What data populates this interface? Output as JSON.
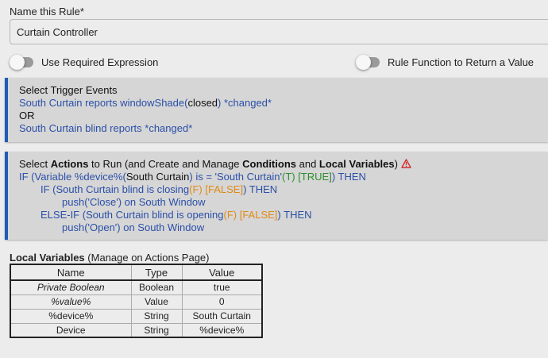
{
  "rule_name": {
    "label": "Name this Rule*",
    "value": "Curtain Controller"
  },
  "toggles": {
    "required_expression": {
      "label": "Use Required Expression",
      "on": false
    },
    "return_value": {
      "label": "Rule Function to Return a Value",
      "on": false
    }
  },
  "triggers": {
    "title": "Select Trigger Events",
    "line1_pre": "South Curtain reports windowShade(",
    "line1_val": "closed",
    "line1_post": ") *changed*",
    "or": "OR",
    "line2": "South Curtain blind reports *changed*"
  },
  "actions": {
    "title_pre": "Select ",
    "title_b1": "Actions",
    "title_mid1": " to Run (and Create and Manage ",
    "title_b2": "Conditions",
    "title_mid2": " and ",
    "title_b3": "Local Variables",
    "title_post": ")",
    "warning_icon": "warning-triangle-icon",
    "l1_a": "IF (Variable %device%(",
    "l1_b": "South Curtain",
    "l1_c": ") is = 'South Curtain'",
    "l1_d": "(T) [TRUE]",
    "l1_e": ") THEN",
    "l2_a": "IF (South Curtain blind is closing",
    "l2_b": "(F) [FALSE]",
    "l2_c": ") THEN",
    "l3": "push('Close') on South Window",
    "l4_a": "ELSE-IF (South Curtain blind is opening",
    "l4_b": "(F) [FALSE]",
    "l4_c": ") THEN",
    "l5": "push('Open') on South Window"
  },
  "local_vars": {
    "title_bold": "Local Variables",
    "title_rest": " (Manage on Actions Page)",
    "headers": [
      "Name",
      "Type",
      "Value"
    ],
    "rows": [
      {
        "name": "Private Boolean",
        "type": "Boolean",
        "value": "true"
      },
      {
        "name": "%value%",
        "type": "Value",
        "value": "0"
      },
      {
        "name": "%device%",
        "type": "String",
        "value": "South Curtain"
      },
      {
        "name": "Device",
        "type": "String",
        "value": "%device%"
      }
    ]
  },
  "colors": {
    "blue_text": "#2b4fa8",
    "orange_false": "#e08a16",
    "green_true": "#2d8f2d",
    "panel_accent": "#1e5bb5",
    "warning": "#d32020"
  }
}
